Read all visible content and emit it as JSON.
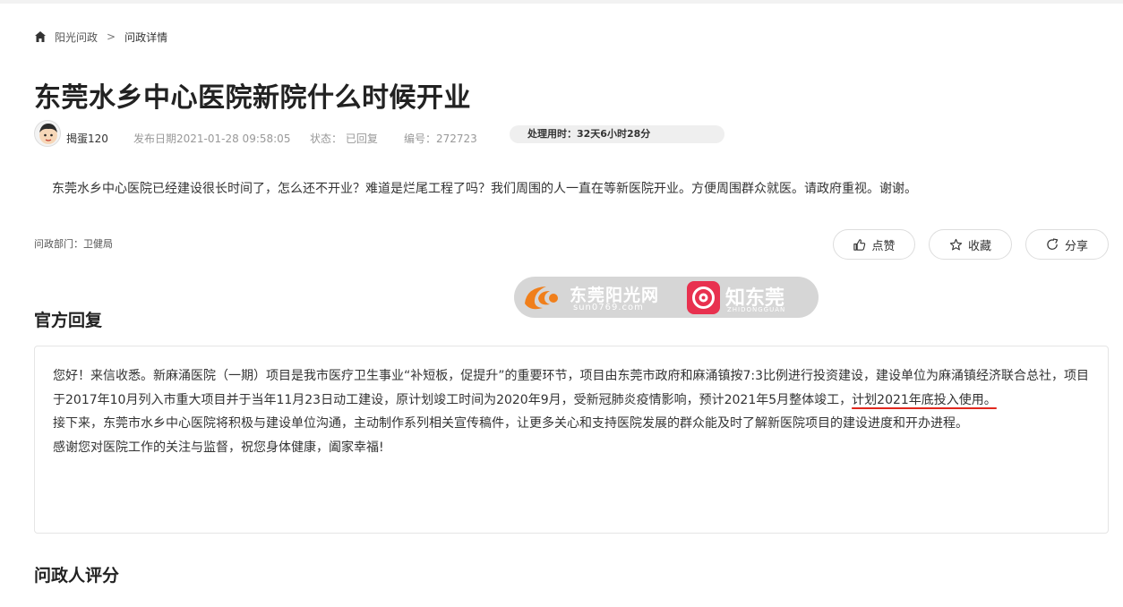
{
  "breadcrumb": {
    "root": "阳光问政",
    "separator": ">",
    "current": "问政详情"
  },
  "title": "东莞水乡中心医院新院什么时候开业",
  "meta": {
    "author": "揭蛋120",
    "date": "发布日期2021-01-28 09:58:05",
    "status": "状态： 已回复",
    "number": "编号：272723",
    "timer": "处理用时：32天6小时28分"
  },
  "question": "东莞水乡中心医院已经建设很长时间了，怎么还不开业？难道是烂尾工程了吗？我们周围的人一直在等新医院开业。方便周围群众就医。请政府重视。谢谢。",
  "department": "问政部门：卫健局",
  "actions": {
    "like": "点赞",
    "collect": "收藏",
    "share": "分享"
  },
  "watermark": {
    "left_name": "东莞阳光网",
    "left_url": "sun0769.com",
    "right_name": "知东莞",
    "right_sub": "ZHIDONGGUAN"
  },
  "reply": {
    "heading": "官方回复",
    "p1_text": "您好！来信收悉。新麻涌医院（一期）项目是我市医疗卫生事业“补短板，促提升”的重要环节，项目由东莞市政府和麻涌镇按7:3比例进行投资建设，建设单位为麻涌镇经济联合总社，项目于2017年10月列入市重大项目并于当年11月23日动工建设，原计划竣工时间为2020年9月，受新冠肺炎疫情影响，预计2021年5月整体竣工，",
    "p1_highlight": "计划2021年底投入使用。",
    "p2": "接下来，东莞市水乡中心医院将积极与建设单位沟通，主动制作系列相关宣传稿件，让更多关心和支持医院发展的群众能及时了解新医院项目的建设进度和开办进程。",
    "p3": "感谢您对医院工作的关注与监督，祝您身体健康，阖家幸福!"
  },
  "rating": {
    "heading": "问政人评分"
  }
}
